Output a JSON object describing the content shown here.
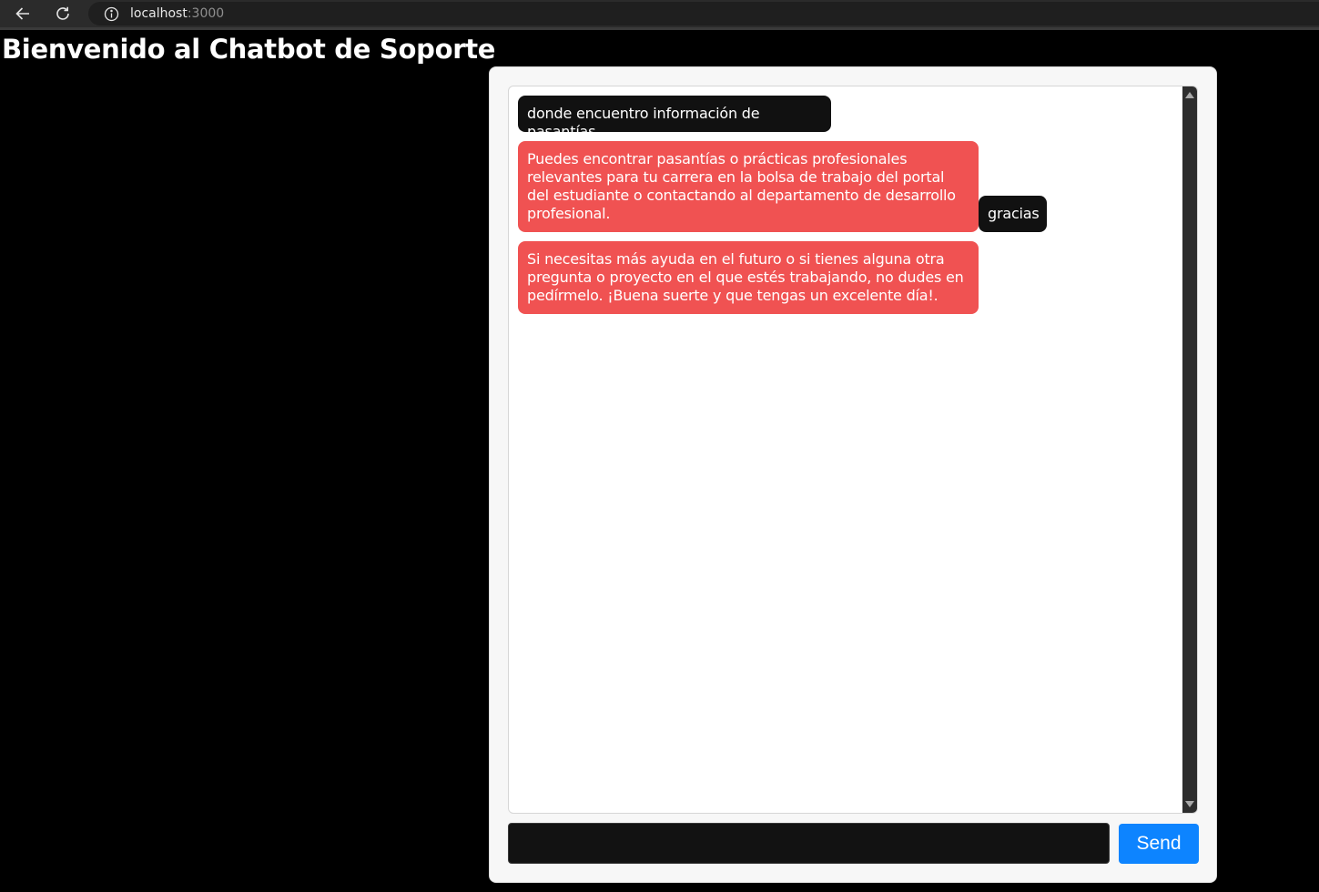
{
  "browser": {
    "url_host": "localhost",
    "url_port": ":3000"
  },
  "page": {
    "title": "Bienvenido al Chatbot de Soporte"
  },
  "chat": {
    "messages": [
      {
        "role": "user",
        "text": "donde encuentro información de pasantías"
      },
      {
        "role": "bot",
        "text": "Puedes encontrar pasantías o prácticas profesionales relevantes para tu carrera en la bolsa de trabajo del portal del estudiante o contactando al departamento de desarrollo profesional."
      },
      {
        "role": "user",
        "text": "gracias"
      },
      {
        "role": "bot",
        "text": "Si necesitas más ayuda en el futuro o si tienes alguna otra pregunta o proyecto en el que estés trabajando, no dudes en pedírmelo. ¡Buena suerte y que tengas un excelente día!."
      }
    ],
    "input_value": "",
    "send_label": "Send"
  },
  "colors": {
    "user_bubble": "#111111",
    "bot_bubble": "#f05252",
    "send_button": "#0d84ff",
    "page_background": "#000000"
  },
  "icons": {
    "back": "arrow-left-icon",
    "reload": "reload-icon",
    "info": "info-icon"
  }
}
